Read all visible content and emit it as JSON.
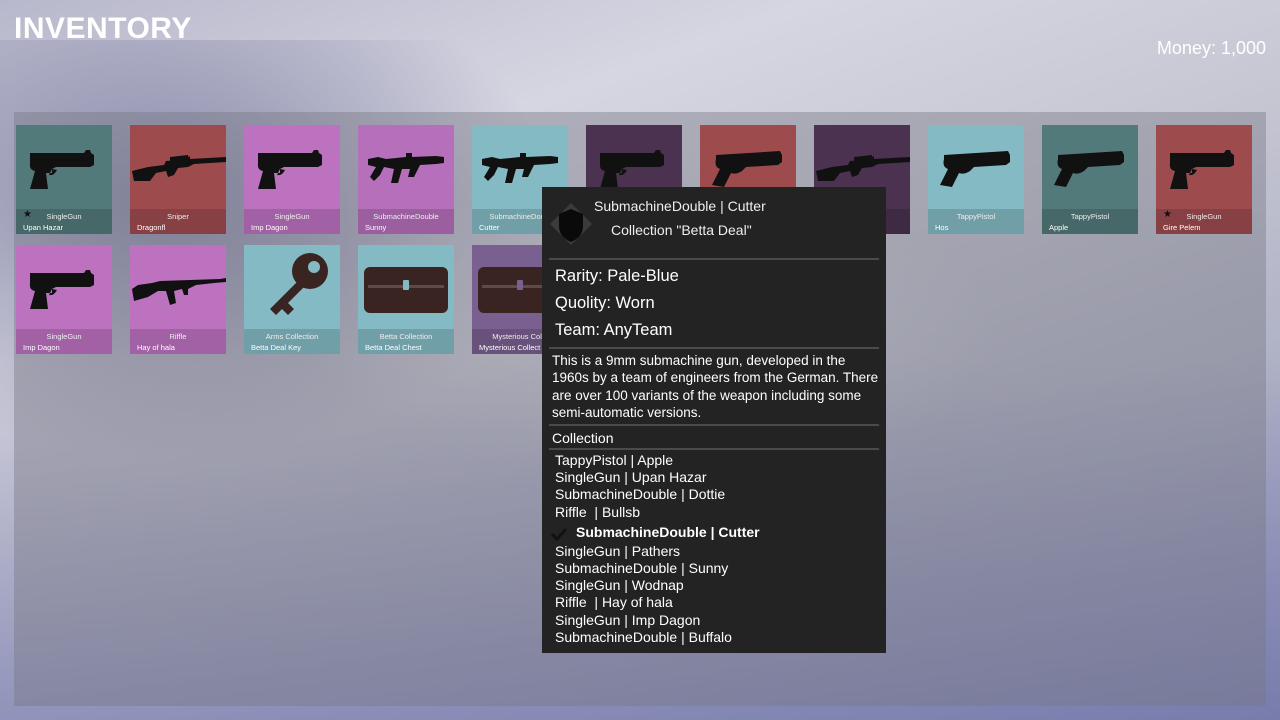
{
  "header": {
    "title": "INVENTORY",
    "money": "Money: 1,000"
  },
  "colors": {
    "teal_dark": "#537a7b",
    "red": "#9e4b4e",
    "pink": "#bd72c0",
    "light_blue": "#84bac4",
    "dark_purple": "#4a3250",
    "silhouette": "#111111",
    "chest": "#3a2422",
    "key": "#3a2422",
    "tooltip_bg": "#232323"
  },
  "items": [
    {
      "type": "SingleGun",
      "name": "Upan Hazar",
      "icon": "pistol-icon",
      "bg": "#537a7b",
      "starred": true
    },
    {
      "type": "Sniper",
      "name": "Dragonfl",
      "icon": "sniper-icon",
      "bg": "#9e4b4e",
      "starred": false
    },
    {
      "type": "SingleGun",
      "name": "Imp Dagon",
      "icon": "pistol-icon",
      "bg": "#bd72c0",
      "starred": false
    },
    {
      "type": "SubmachineDouble",
      "name": "Sunny",
      "icon": "smg-icon",
      "bg": "#b56fbb",
      "starred": false
    },
    {
      "type": "SubmachineDoubl",
      "name": "Cutter",
      "icon": "smg-icon",
      "bg": "#84bac4",
      "starred": false
    },
    {
      "type": "",
      "name": "",
      "icon": "pistol-icon",
      "bg": "#4a3250",
      "starred": false
    },
    {
      "type": "",
      "name": "",
      "icon": "compact-pistol-icon",
      "bg": "#9e4b4e",
      "starred": false
    },
    {
      "type": "",
      "name": "",
      "icon": "sniper-icon",
      "bg": "#4a3250",
      "starred": false
    },
    {
      "type": "TappyPistol",
      "name": "Hos",
      "icon": "compact-pistol-icon",
      "bg": "#84bac4",
      "starred": false
    },
    {
      "type": "TappyPistol",
      "name": "Apple",
      "icon": "compact-pistol-icon",
      "bg": "#537a7b",
      "starred": false
    },
    {
      "type": "SingleGun",
      "name": "Gire Pelem",
      "icon": "pistol-icon",
      "bg": "#9e4b4e",
      "starred": true
    },
    {
      "type": "SingleGun",
      "name": "Imp Dagon",
      "icon": "pistol-icon",
      "bg": "#bd72c0",
      "starred": false
    },
    {
      "type": "Riffle",
      "name": "Hay of hala",
      "icon": "rifle-icon",
      "bg": "#bd72c0",
      "starred": false
    },
    {
      "type": "Arms Collection",
      "name": "Betta Deal Key",
      "icon": "key-icon",
      "bg": "#84bac4",
      "starred": false
    },
    {
      "type": "Betta Collection",
      "name": "Betta Deal Chest",
      "icon": "chest-icon",
      "bg": "#84bac4",
      "starred": false
    },
    {
      "type": "Mysterious Colle",
      "name": "Mysterious Collect",
      "icon": "chest-icon",
      "bg": "#7a6090",
      "starred": false
    }
  ],
  "tooltip": {
    "name": "SubmachineDouble | Cutter",
    "collection": "Collection \"Betta Deal\"",
    "rarity": "Rarity: Pale-Blue",
    "quality": "Quolity: Worn",
    "team": "Team: AnyTeam",
    "description": "This is a 9mm submachine gun, developed in the 1960s by a team of engineers from the German. There are over 100 variants of the weapon including some semi-automatic versions.",
    "collection_title": "Collection",
    "collection_items": [
      {
        "label": "TappyPistol | Apple",
        "selected": false
      },
      {
        "label": "SingleGun | Upan Hazar",
        "selected": false
      },
      {
        "label": "SubmachineDouble | Dottie",
        "selected": false
      },
      {
        "label": "Riffle  | Bullsb",
        "selected": false
      },
      {
        "label": "SubmachineDouble | Cutter",
        "selected": true
      },
      {
        "label": "SingleGun | Pathers",
        "selected": false
      },
      {
        "label": "SubmachineDouble | Sunny",
        "selected": false
      },
      {
        "label": "SingleGun | Wodnap",
        "selected": false
      },
      {
        "label": "Riffle  | Hay of hala",
        "selected": false
      },
      {
        "label": "SingleGun | Imp Dagon",
        "selected": false
      },
      {
        "label": "SubmachineDouble | Buffalo",
        "selected": false
      }
    ]
  }
}
